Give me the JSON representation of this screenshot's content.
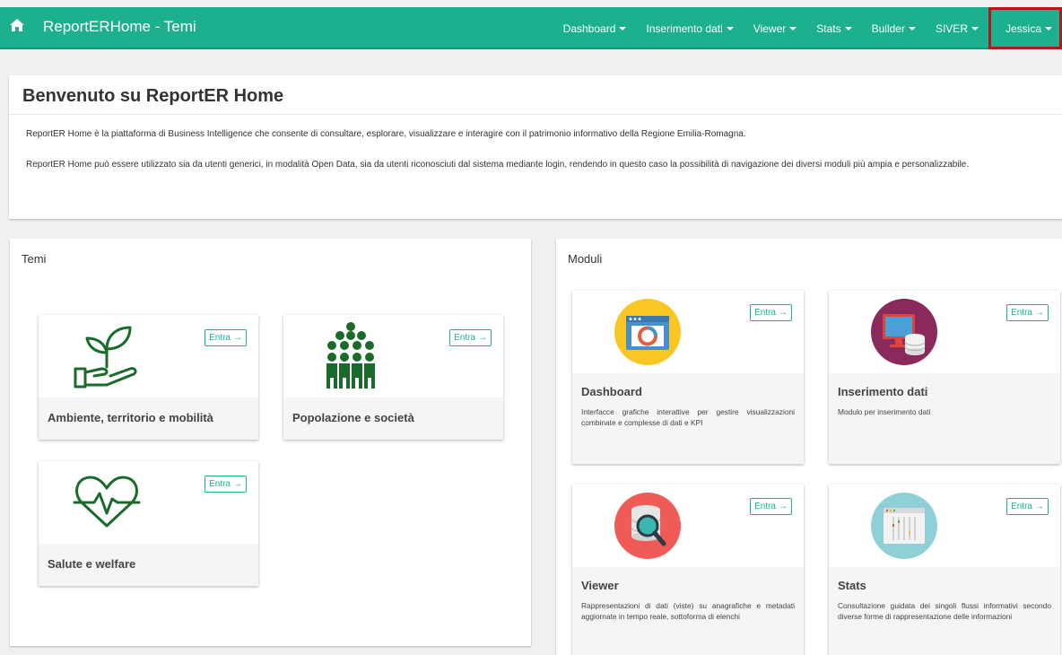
{
  "navbar": {
    "brand": "ReportERHome - Temi",
    "menu": [
      {
        "label": "Dashboard"
      },
      {
        "label": "Inserimento dati"
      },
      {
        "label": "Viewer"
      },
      {
        "label": "Stats"
      },
      {
        "label": "Builder"
      },
      {
        "label": "SIVER"
      },
      {
        "label": "Jessica"
      }
    ]
  },
  "welcome": {
    "title": "Benvenuto su ReportER Home",
    "paragraph1": "ReportER Home è la piattaforma di Business Intelligence che consente di consultare, esplorare, visualizzare e interagire con il patrimonio informativo della Regione Emilia-Romagna.",
    "paragraph2": "ReportER Home può essere utilizzato sia da utenti generici, in modalità Open Data, sia da utenti riconosciuti dal sistema mediante login, rendendo in questo caso la possibilità di navigazione dei diversi moduli più ampia e personalizzabile."
  },
  "temi": {
    "title": "Temi",
    "cards": [
      {
        "title": "Ambiente, territorio e mobilità",
        "button": "Entra",
        "icon": "plant-hand-icon"
      },
      {
        "title": "Popolazione e società",
        "button": "Entra",
        "icon": "people-crowd-icon"
      },
      {
        "title": "Salute e welfare",
        "button": "Entra",
        "icon": "heart-pulse-icon"
      }
    ]
  },
  "moduli": {
    "title": "Moduli",
    "cards": [
      {
        "title": "Dashboard",
        "description": "Interfacce grafiche interattive per gestire visualizzazioni combinate e complesse di dati e KPI",
        "button": "Entra",
        "icon": "dashboard-icon"
      },
      {
        "title": "Inserimento dati",
        "description": "Modulo per inserimento dati",
        "button": "Entra",
        "icon": "data-entry-icon"
      },
      {
        "title": "Viewer",
        "description": "Rappresentazioni di dati (viste) su anagrafiche e metadati aggiornate in tempo reale, sottoforma di elenchi",
        "button": "Entra",
        "icon": "viewer-icon"
      },
      {
        "title": "Stats",
        "description": "Consultazione guidata dei singoli flussi informativi secondo diverse forme di rappresentazione delle informazioni",
        "button": "Entra",
        "icon": "stats-icon"
      }
    ]
  },
  "colors": {
    "brand": "#1cb08f",
    "theme_icon": "#1a6b2a",
    "highlight_border": "#b01a1a"
  }
}
